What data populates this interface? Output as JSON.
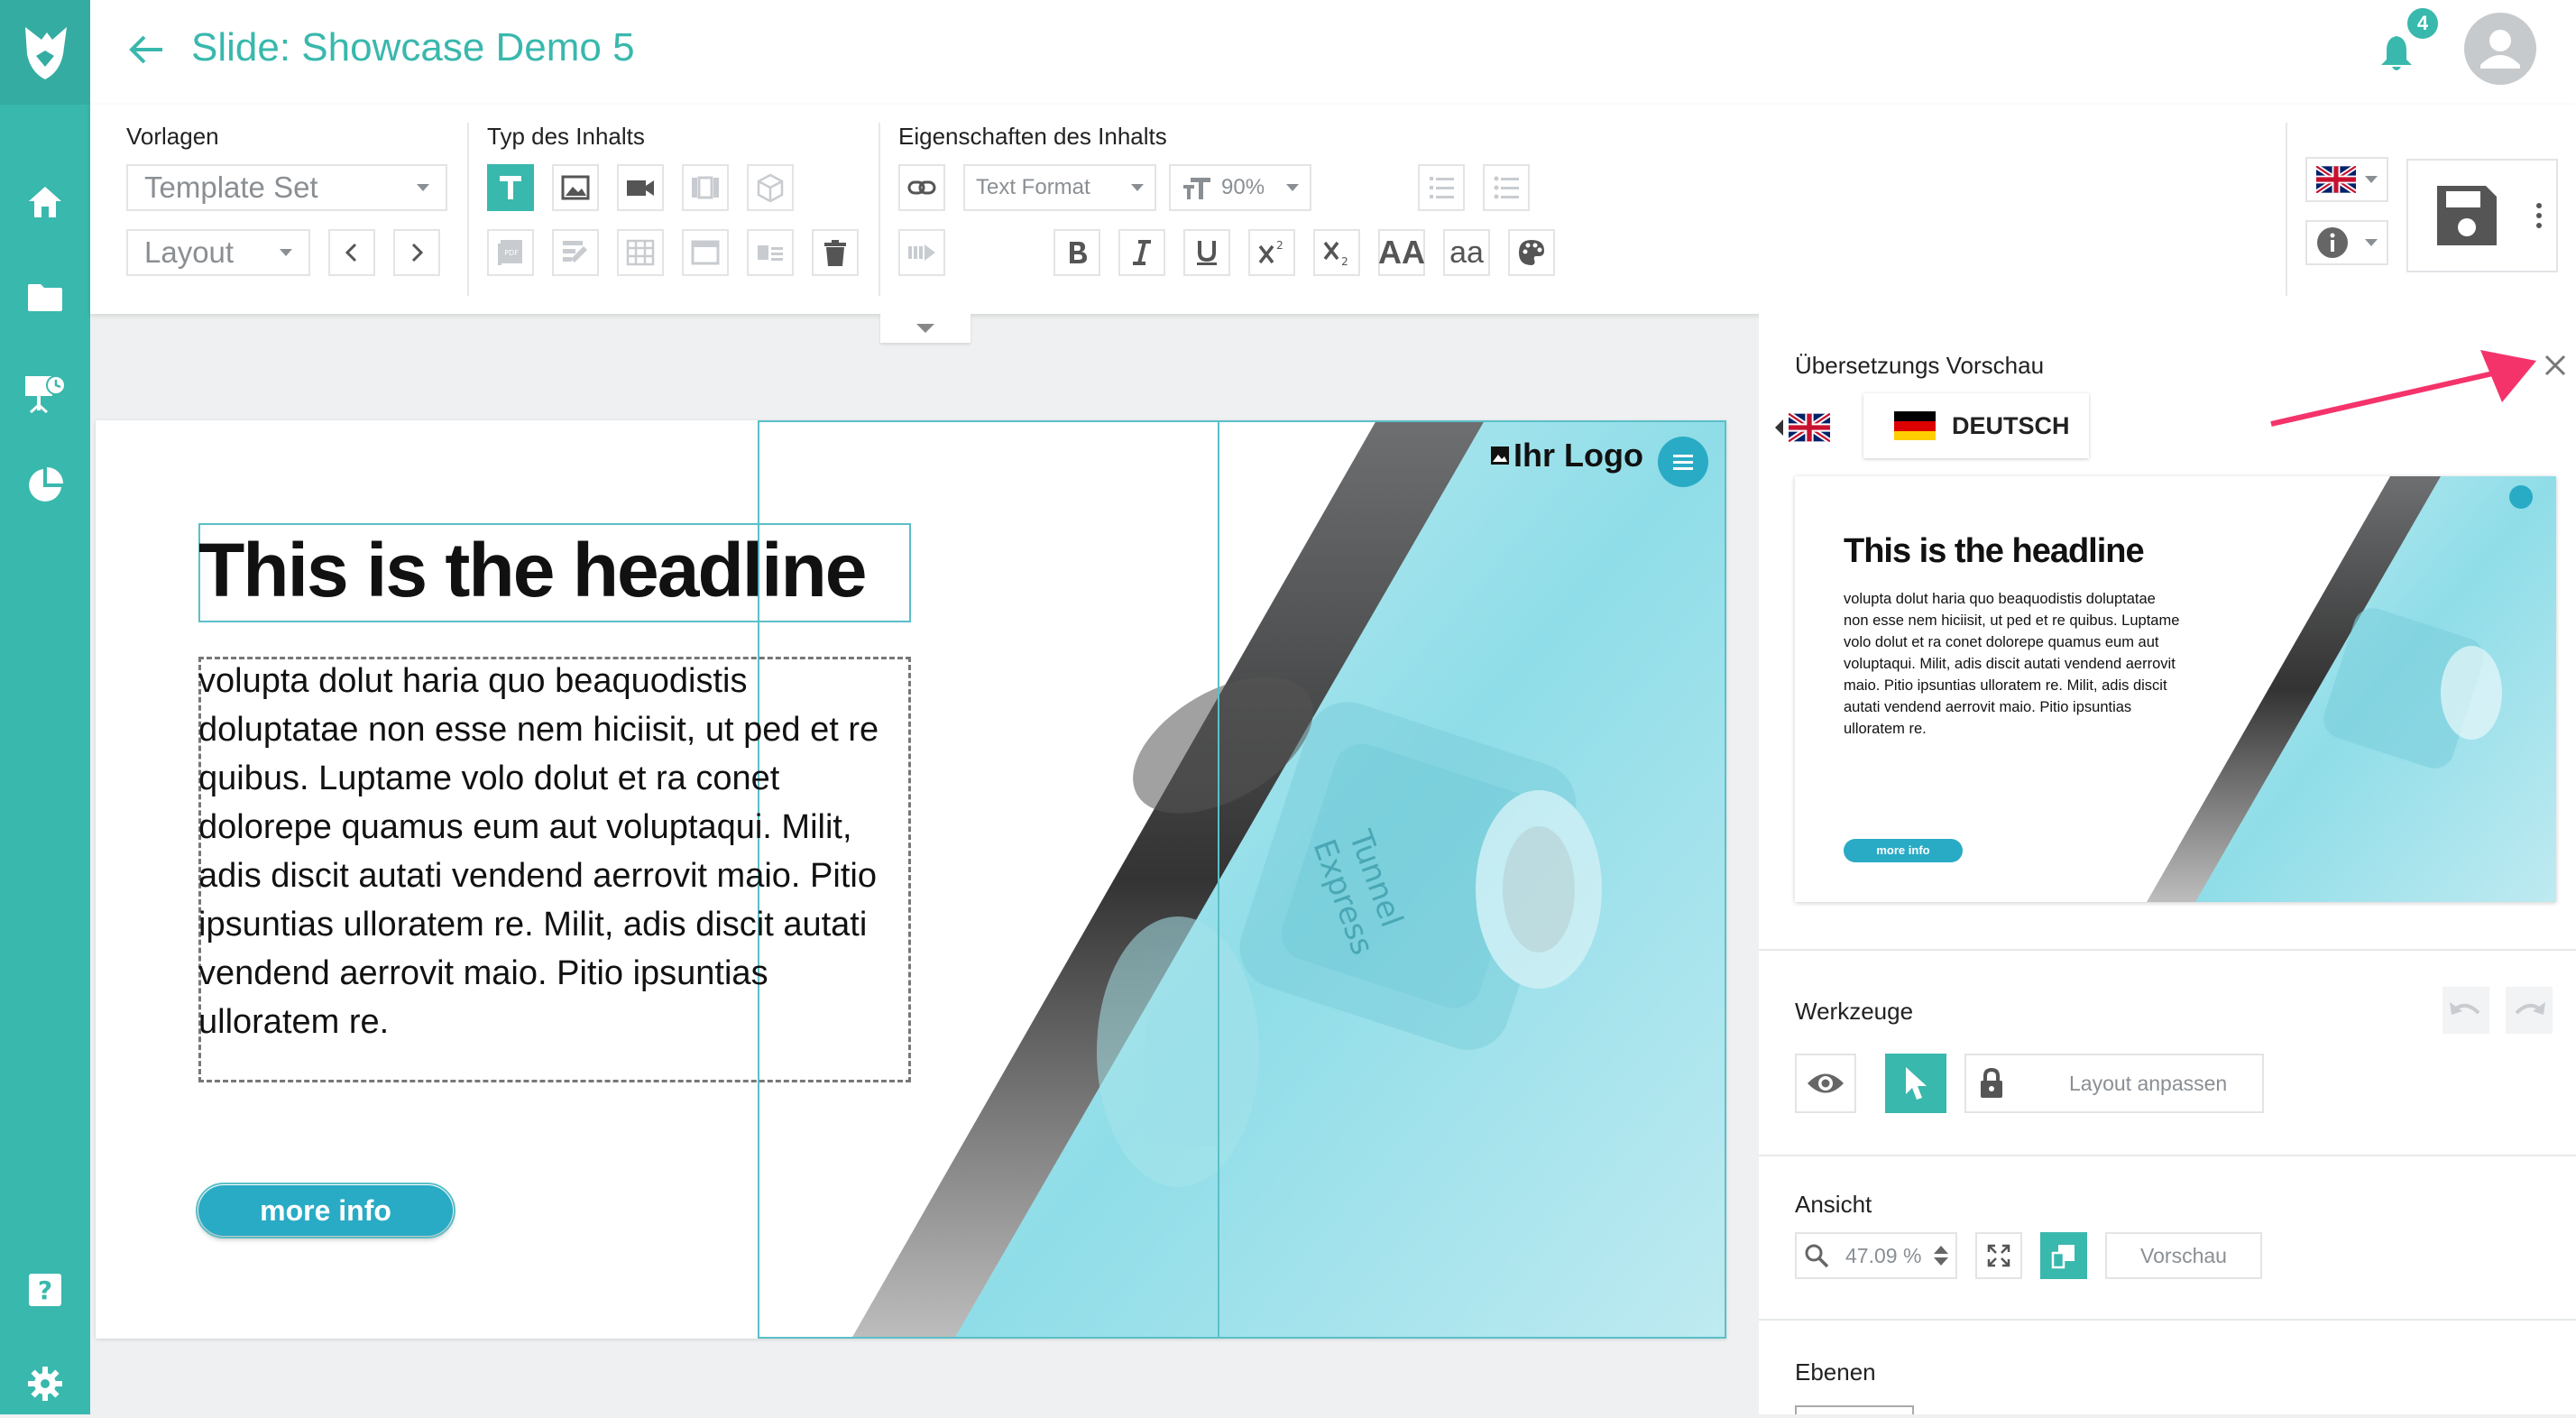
{
  "colors": {
    "accent": "#39b8ad",
    "accent_dark": "#35aca2",
    "button_blue": "#29abc5",
    "arrow": "#f5336b"
  },
  "icons": {
    "logo": "fox-logo-icon",
    "home": "home-icon",
    "folder": "folder-icon",
    "presentation": "presentation-icon",
    "chart": "pie-chart-icon",
    "help": "help-icon",
    "settings": "gear-icon"
  },
  "header": {
    "title": "Slide: Showcase Demo 5",
    "notification_count": "4"
  },
  "toolbar": {
    "vorlagen": {
      "label": "Vorlagen",
      "template_set": "Template Set",
      "layout": "Layout"
    },
    "typ": {
      "label": "Typ des Inhalts"
    },
    "eigenschaften": {
      "label": "Eigenschaften des Inhalts",
      "text_format": "Text Format",
      "font_size": "90%",
      "superscript": "2",
      "subscript": "2",
      "font_icon": "AA",
      "case_icon": "aa"
    }
  },
  "slide": {
    "headline": "This is the headline",
    "body": "volupta dolut haria quo beaquodistis doluptatae non esse nem hiciisit, ut ped et re quibus. Luptame volo dolut et ra conet dolorepe quamus eum aut voluptaqui. Milit, adis discit autati vendend aerrovit maio. Pitio ipsuntias ulloratem re. Milit, adis discit autati vendend aerrovit maio. Pitio ipsuntias ulloratem re.",
    "button": "more info",
    "logo": "Ihr Logo",
    "watch": {
      "line1": "Tunnel",
      "line2": "Express"
    }
  },
  "panel": {
    "preview_title": "Übersetzungs Vorschau",
    "language": "DEUTSCH",
    "preview": {
      "headline": "This is the headline",
      "body": "volupta dolut haria quo beaquodistis doluptatae non esse nem hiciisit, ut ped et re quibus. Luptame volo dolut et ra conet dolorepe quamus eum aut voluptaqui. Milit, adis discit autati vendend aerrovit maio. Pitio ipsuntias ulloratem re. Milit, adis discit autati vendend aerrovit maio. Pitio ipsuntias ulloratem re.",
      "button": "more info"
    },
    "tools_title": "Werkzeuge",
    "layout_button": "Layout anpassen",
    "view_title": "Ansicht",
    "zoom": "47.09 %",
    "preview_button": "Vorschau",
    "layers_title": "Ebenen"
  }
}
